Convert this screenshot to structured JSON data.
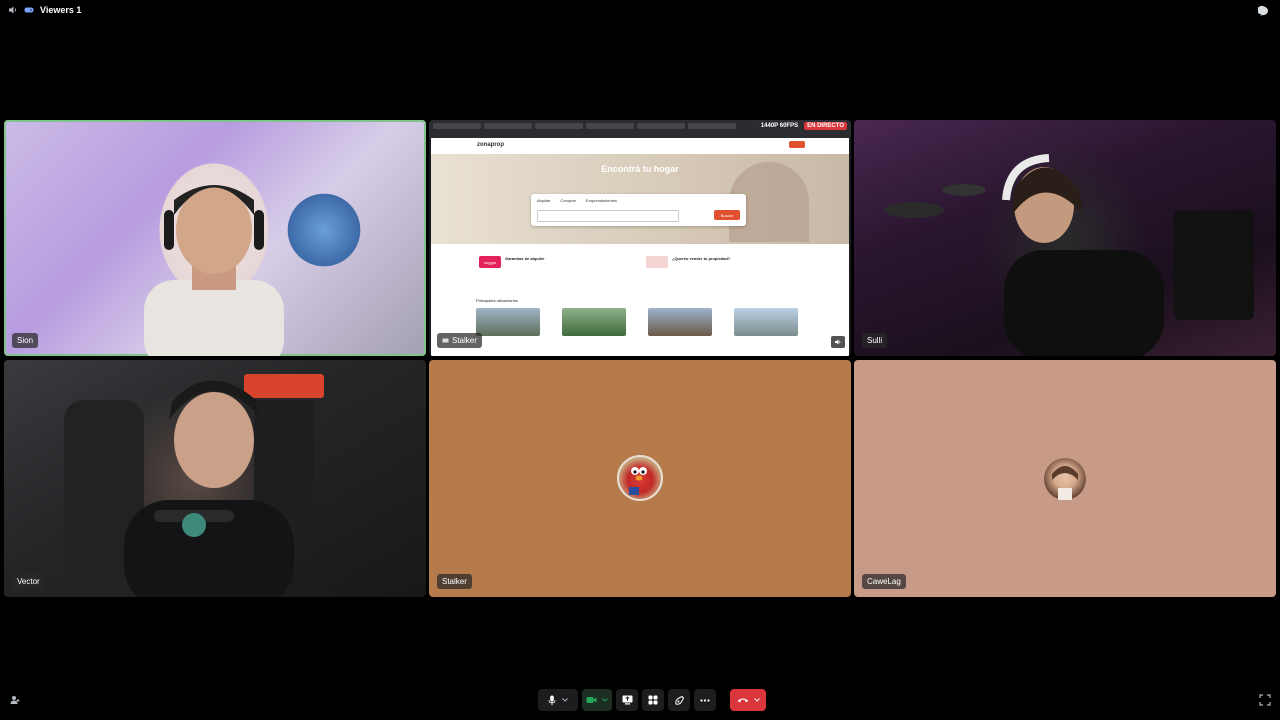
{
  "topbar": {
    "viewers_label": "Viewers 1",
    "icons": [
      "volume-icon",
      "gamepad-icon",
      "chat-bubble-icon"
    ]
  },
  "participants": [
    {
      "name": "Sion",
      "type": "video",
      "speaking": true
    },
    {
      "name": "Stalker",
      "type": "screen-share",
      "badge_resolution": "1440P 60FPS",
      "badge_live": "EN DIRECTO"
    },
    {
      "name": "Sulli",
      "type": "video"
    },
    {
      "name": "Vector",
      "type": "video"
    },
    {
      "name": "Stalker",
      "type": "avatar",
      "color": "#b57b4b"
    },
    {
      "name": "CaweLag",
      "type": "avatar",
      "color": "#c89b88"
    }
  ],
  "shared_page": {
    "brand": "zonaprop",
    "hero_title": "Encontrá tu hogar",
    "search_tabs": [
      "Alquilar",
      "Comprar",
      "Emprendimientos"
    ],
    "search_button": "Buscar",
    "promo_left_logo": "hoggar",
    "promo_left_title": "Garantías de alquiler",
    "promo_right_title": "¿Querés vender tu propiedad?",
    "section_title": "Principales ubicaciones"
  },
  "controls": {
    "items": [
      "microphone",
      "mic-options",
      "camera",
      "camera-options",
      "screen-share",
      "activities",
      "soundboard",
      "more",
      "leave-call",
      "leave-options"
    ],
    "leave_color": "#da373c",
    "camera_color": "#23a55a"
  }
}
